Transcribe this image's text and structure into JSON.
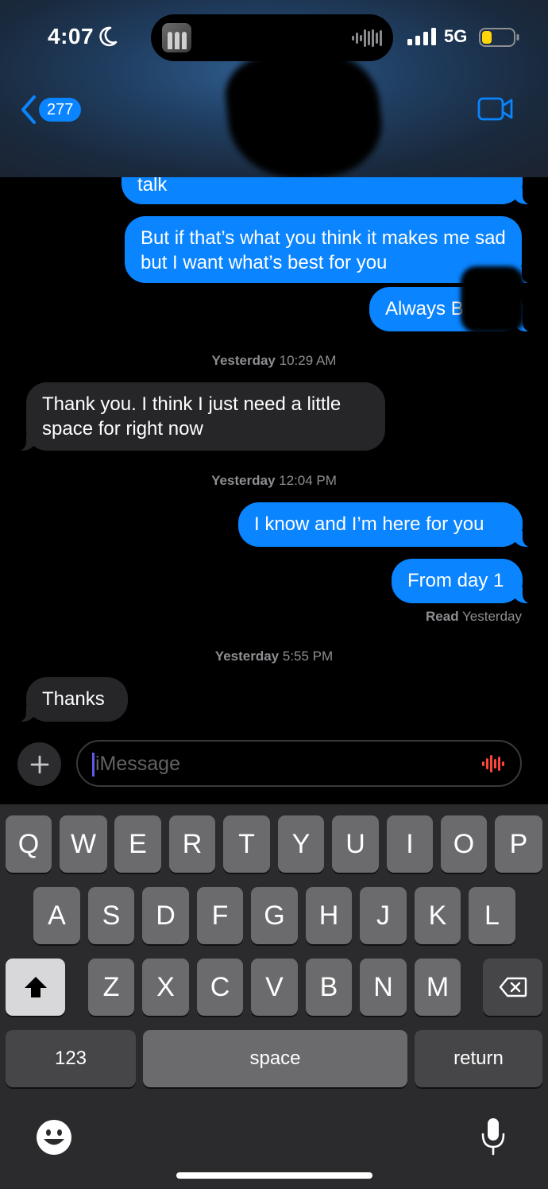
{
  "status_bar": {
    "time": "4:07",
    "network": "5G"
  },
  "nav": {
    "back_count": "277"
  },
  "messages": [
    {
      "text": "talk"
    },
    {
      "text": "But if that’s what you think it makes me sad but I want what’s best for you"
    },
    {
      "text": "Always B"
    },
    {
      "text": "Thank you. I think I just need a little space for right now"
    },
    {
      "text": "I know and I’m here for you"
    },
    {
      "text": "From day 1"
    },
    {
      "text": "Thanks"
    }
  ],
  "timestamps": [
    {
      "day": "Yesterday",
      "time": "10:29 AM"
    },
    {
      "day": "Yesterday",
      "time": "12:04 PM"
    },
    {
      "day": "Yesterday",
      "time": "5:55 PM"
    }
  ],
  "receipt": {
    "status": "Read",
    "when": "Yesterday"
  },
  "input": {
    "placeholder": "iMessage"
  },
  "keyboard": {
    "row1": [
      "Q",
      "W",
      "E",
      "R",
      "T",
      "Y",
      "U",
      "I",
      "O",
      "P"
    ],
    "row2": [
      "A",
      "S",
      "D",
      "F",
      "G",
      "H",
      "J",
      "K",
      "L"
    ],
    "row3": [
      "Z",
      "X",
      "C",
      "V",
      "B",
      "N",
      "M"
    ],
    "numbers_label": "123",
    "space_label": "space",
    "return_label": "return"
  },
  "colors": {
    "outgoing": "#0a84ff",
    "incoming": "#262629",
    "battery": "#ffd60a"
  },
  "icons": [
    "moon-icon",
    "waveform-icon",
    "signal-icon",
    "battery-icon",
    "back-chevron-icon",
    "video-camera-icon",
    "plus-icon",
    "dictation-icon",
    "shift-icon",
    "delete-icon",
    "emoji-icon",
    "microphone-icon"
  ]
}
